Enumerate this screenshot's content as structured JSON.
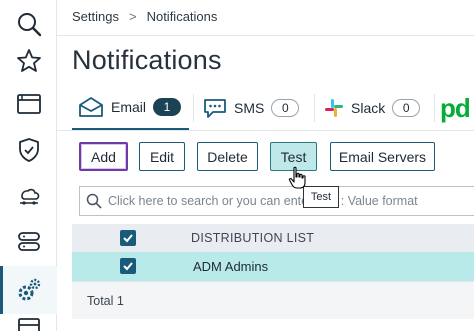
{
  "breadcrumb": {
    "parent": "Settings",
    "separator": ">",
    "current": "Notifications"
  },
  "page_title": "Notifications",
  "sidebar": {
    "items": [
      {
        "icon": "search-icon"
      },
      {
        "icon": "star-icon"
      },
      {
        "icon": "browser-window-icon"
      },
      {
        "icon": "shield-check-icon"
      },
      {
        "icon": "cloud-link-icon"
      },
      {
        "icon": "database-icon"
      },
      {
        "icon": "settings-gears-icon",
        "active": true
      },
      {
        "icon": "calendar-icon"
      }
    ]
  },
  "tabs": [
    {
      "label": "Email",
      "count": "1",
      "icon": "envelope-icon",
      "active": true
    },
    {
      "label": "SMS",
      "count": "0",
      "icon": "chat-bubble-icon"
    },
    {
      "label": "Slack",
      "count": "0",
      "icon": "slack-icon"
    },
    {
      "label": "pd",
      "icon": "pagerduty-logo"
    }
  ],
  "toolbar": {
    "add_label": "Add",
    "edit_label": "Edit",
    "delete_label": "Delete",
    "test_label": "Test",
    "email_servers_label": "Email Servers"
  },
  "tooltip": {
    "text": "Test"
  },
  "search": {
    "placeholder": "Click here to search or you can enter Key : Value format"
  },
  "table": {
    "columns": [
      "DISTRIBUTION LIST"
    ],
    "rows": [
      {
        "name": "ADM Admins",
        "checked": true
      }
    ],
    "total": "Total 1"
  },
  "colors": {
    "accent": "#1a5b7a",
    "selected_row": "#b9eaea",
    "badge": "#1c4354",
    "focus": "#6d3aa6"
  }
}
